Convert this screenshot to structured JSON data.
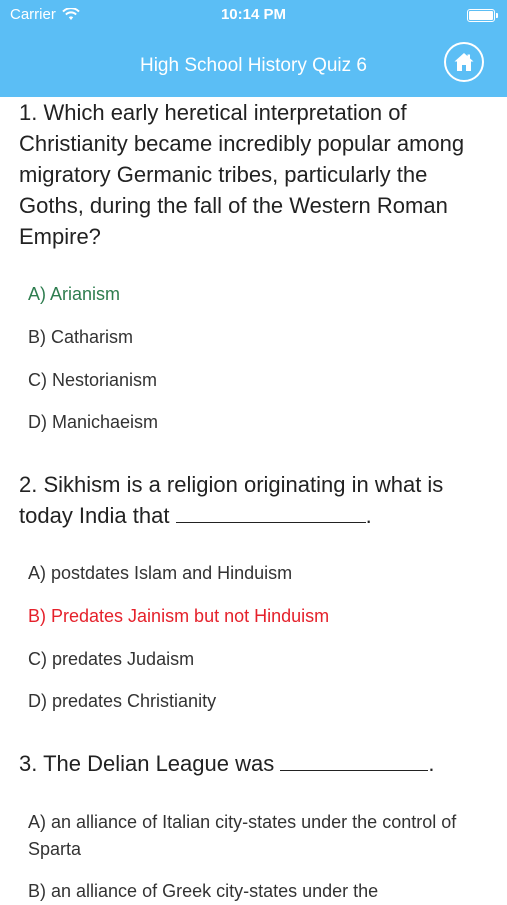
{
  "status_bar": {
    "carrier": "Carrier",
    "time": "10:14 PM"
  },
  "header": {
    "title": "High School History Quiz 6",
    "home_icon": "home-icon"
  },
  "colors": {
    "header_bg": "#5BBEF5",
    "correct": "#2E7D4F",
    "wrong": "#E5212B"
  },
  "questions": [
    {
      "text": "1. Which early heretical interpretation of Christianity became incredibly popular among migratory Germanic tribes, particularly the Goths, during the fall of the Western Roman Empire?",
      "options": [
        "A) Arianism",
        "B) Catharism",
        "C) Nestorianism",
        "D) Manichaeism"
      ]
    },
    {
      "text_before": "2. Sikhism is a religion originating in what is today India that",
      "text_after": ".",
      "options": [
        "A) postdates Islam and Hinduism",
        "B) Predates Jainism but not Hinduism",
        "C) predates Judaism",
        "D) predates Christianity"
      ]
    },
    {
      "text_before": "3. The Delian League was",
      "text_after": ".",
      "options": [
        "A) an alliance of Italian city-states under the control of Sparta",
        "B) an alliance of Greek city-states under the"
      ]
    }
  ]
}
